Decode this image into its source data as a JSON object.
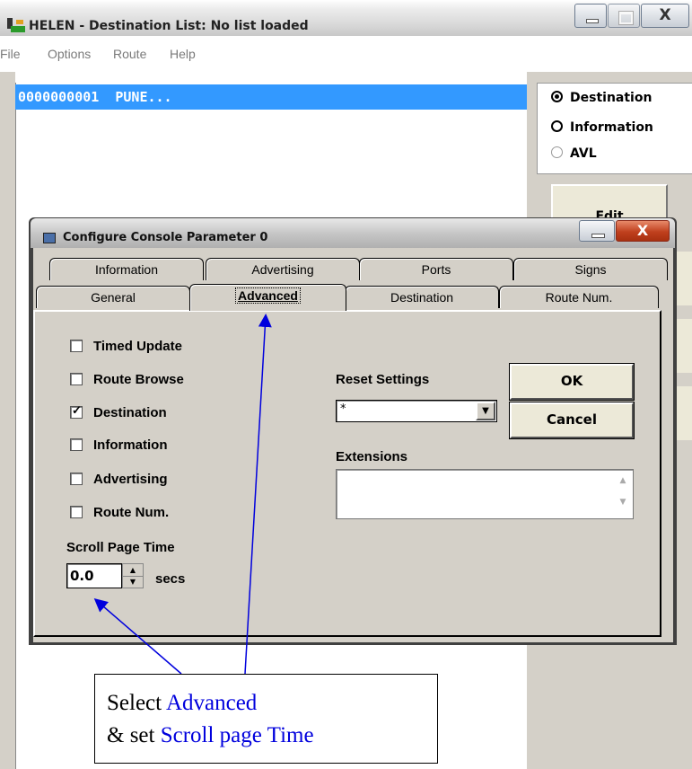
{
  "window": {
    "title": "HELEN - Destination List: No list loaded",
    "close_glyph": "X"
  },
  "menu": [
    "File",
    "Options",
    "Route",
    "Help"
  ],
  "list": {
    "rows": [
      "0000000001  PUNE..."
    ],
    "selected_color": "#3399ff"
  },
  "mode_radios": {
    "items": [
      {
        "label": "Destination",
        "selected": true
      },
      {
        "label": "Information",
        "selected": false
      },
      {
        "label": "AVL",
        "selected": false
      }
    ]
  },
  "side_button": "Edit",
  "dialog": {
    "title": "Configure Console Parameter 0",
    "close_glyph": "X",
    "tabs_back": [
      "Information",
      "Advertising",
      "Ports",
      "Signs"
    ],
    "tabs_front": [
      "General",
      "Advanced",
      "Destination",
      "Route Num."
    ],
    "active_tab": "Advanced",
    "checkboxes": [
      {
        "label": "Timed Update",
        "checked": false
      },
      {
        "label": "Route Browse",
        "checked": false
      },
      {
        "label": "Destination",
        "checked": true
      },
      {
        "label": "Information",
        "checked": false
      },
      {
        "label": "Advertising",
        "checked": false
      },
      {
        "label": "Route Num.",
        "checked": false
      }
    ],
    "scroll_page_time": {
      "label": "Scroll Page Time",
      "value": "0.0",
      "unit": "secs"
    },
    "reset_settings": {
      "label": "Reset Settings",
      "value": "*"
    },
    "extensions": {
      "label": "Extensions",
      "value": ""
    },
    "ok_label": "OK",
    "cancel_label": "Cancel"
  },
  "callout": {
    "line1_prefix": "Select ",
    "line1_highlight": "Advanced",
    "line2_prefix": "& set ",
    "line2_highlight": "Scroll page Time",
    "highlight_color": "#0000dd"
  }
}
